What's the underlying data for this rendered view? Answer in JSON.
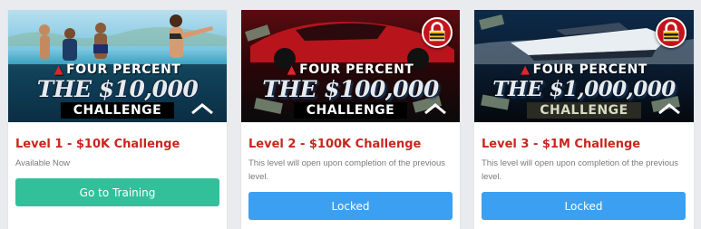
{
  "cards": [
    {
      "banner": {
        "brand": "FOUR PERCENT",
        "headline": "THE $10,000",
        "subtitle": "CHALLENGE",
        "scene": "people-at-beach",
        "locked": false
      },
      "title": "Level 1 - $10K Challenge",
      "description": "Available Now",
      "button": {
        "label": "Go to Training",
        "color": "#32c09b"
      }
    },
    {
      "banner": {
        "brand": "FOUR PERCENT",
        "headline": "THE $100,000",
        "subtitle": "CHALLENGE",
        "scene": "red-sports-car-with-cash",
        "locked": true,
        "lock_icon": "padlock-icon"
      },
      "title": "Level 2 - $100K Challenge",
      "description": "This level will open upon completion of the previous level.",
      "button": {
        "label": "Locked",
        "color": "#3ba0f2"
      }
    },
    {
      "banner": {
        "brand": "FOUR PERCENT",
        "headline": "THE $1,000,000",
        "subtitle": "CHALLENGE",
        "scene": "yacht-with-cash",
        "locked": true,
        "lock_icon": "padlock-icon"
      },
      "title": "Level 3 - $1M Challenge",
      "description": "This level will open upon completion of the previous level.",
      "button": {
        "label": "Locked",
        "color": "#3ba0f2"
      }
    }
  ],
  "colors": {
    "page_background": "#e9ebee",
    "title_red": "#c8261e",
    "muted_text": "#7a7a7a"
  }
}
